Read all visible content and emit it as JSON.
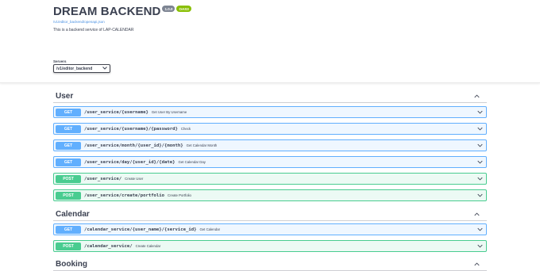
{
  "info": {
    "title": "DREAM BACKEND",
    "version": "1.0.0",
    "oas": "OAS3",
    "base_url": "/v1/editor_backend/openapi.json",
    "description": "This is a backend service of LAP-CALENDAR"
  },
  "servers": {
    "label": "Servers",
    "selected": "/v1/editor_backend"
  },
  "sections": {
    "user": {
      "name": "User",
      "ops": [
        {
          "method": "GET",
          "path": "/user_service/{username}",
          "summary": "Get User By Username"
        },
        {
          "method": "GET",
          "path": "/user_service/{username}/{password}",
          "summary": "Check"
        },
        {
          "method": "GET",
          "path": "/user_service/month/{user_id}/{month}",
          "summary": "Get Calendar Month"
        },
        {
          "method": "GET",
          "path": "/user_service/day/{user_id}/{date}",
          "summary": "Get Calendar Day"
        },
        {
          "method": "POST",
          "path": "/user_service/",
          "summary": "Create User"
        },
        {
          "method": "POST",
          "path": "/user_service/create/portfolio",
          "summary": "Create Portfolio"
        }
      ]
    },
    "calendar": {
      "name": "Calendar",
      "ops": [
        {
          "method": "GET",
          "path": "/calendar_service/{user_name}/{service_id}",
          "summary": "Get Calendar"
        },
        {
          "method": "POST",
          "path": "/calendar_service/",
          "summary": "Create Calendar"
        }
      ]
    },
    "booking": {
      "name": "Booking"
    }
  },
  "icons": {
    "collapse": "chevron-up-icon",
    "expand": "chevron-down-icon"
  },
  "colors": {
    "get": "#61affe",
    "post": "#49cc90",
    "version_badge": "#7d8492",
    "oas_badge": "#89bf04",
    "link": "#4990e2"
  }
}
